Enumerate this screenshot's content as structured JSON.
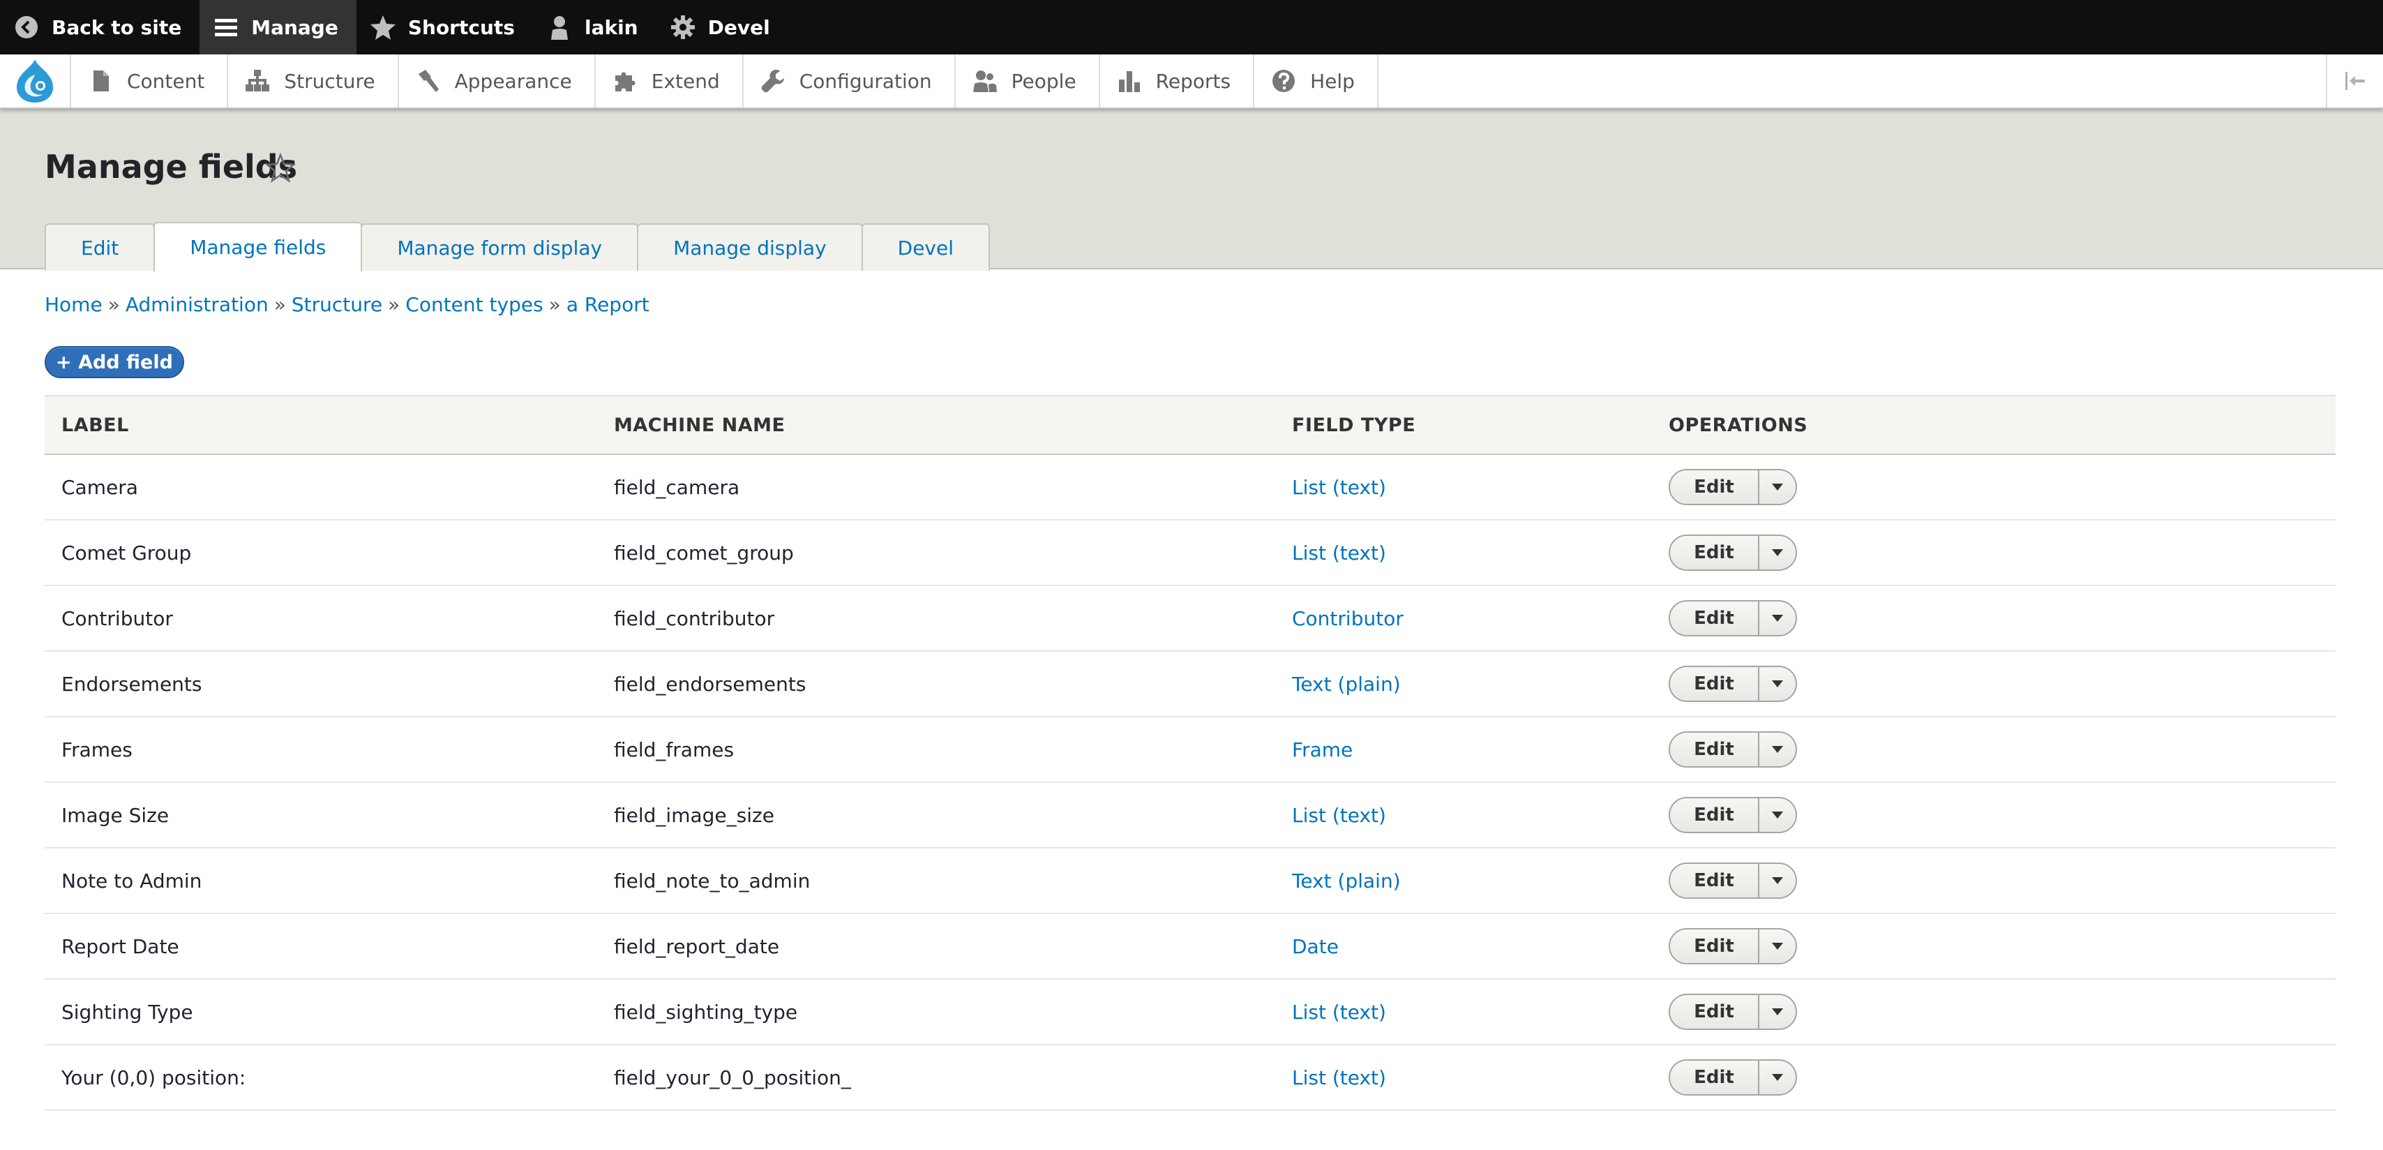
{
  "toolbar": {
    "items": [
      {
        "label": "Back to site",
        "icon": "back-arrow-circle-icon"
      },
      {
        "label": "Manage",
        "icon": "hamburger-menu-icon"
      },
      {
        "label": "Shortcuts",
        "icon": "star-icon"
      },
      {
        "label": "lakin",
        "icon": "user-icon"
      },
      {
        "label": "Devel",
        "icon": "gear-icon"
      }
    ]
  },
  "admin_menu": {
    "logo": "drupal-drop-icon",
    "items": [
      {
        "label": "Content",
        "icon": "page-icon"
      },
      {
        "label": "Structure",
        "icon": "sitemap-icon"
      },
      {
        "label": "Appearance",
        "icon": "paint-brush-icon"
      },
      {
        "label": "Extend",
        "icon": "puzzle-icon"
      },
      {
        "label": "Configuration",
        "icon": "wrench-icon"
      },
      {
        "label": "People",
        "icon": "people-icon"
      },
      {
        "label": "Reports",
        "icon": "bar-chart-icon"
      },
      {
        "label": "Help",
        "icon": "help-circle-icon"
      }
    ]
  },
  "page": {
    "title": "Manage fields"
  },
  "tabs": [
    {
      "label": "Edit",
      "active": false
    },
    {
      "label": "Manage fields",
      "active": true
    },
    {
      "label": "Manage form display",
      "active": false
    },
    {
      "label": "Manage display",
      "active": false
    },
    {
      "label": "Devel",
      "active": false
    }
  ],
  "breadcrumb": {
    "items": [
      "Home",
      "Administration",
      "Structure",
      "Content types",
      "a Report"
    ],
    "separator": "»"
  },
  "actions": {
    "add_field": "+ Add field"
  },
  "table": {
    "headers": [
      "LABEL",
      "MACHINE NAME",
      "FIELD TYPE",
      "OPERATIONS"
    ],
    "rows": [
      {
        "label": "Camera",
        "machine_name": "field_camera",
        "field_type": "List (text)",
        "op": "Edit"
      },
      {
        "label": "Comet Group",
        "machine_name": "field_comet_group",
        "field_type": "List (text)",
        "op": "Edit"
      },
      {
        "label": "Contributor",
        "machine_name": "field_contributor",
        "field_type": "Contributor",
        "op": "Edit"
      },
      {
        "label": "Endorsements",
        "machine_name": "field_endorsements",
        "field_type": "Text (plain)",
        "op": "Edit"
      },
      {
        "label": "Frames",
        "machine_name": "field_frames",
        "field_type": "Frame",
        "op": "Edit"
      },
      {
        "label": "Image Size",
        "machine_name": "field_image_size",
        "field_type": "List (text)",
        "op": "Edit"
      },
      {
        "label": "Note to Admin",
        "machine_name": "field_note_to_admin",
        "field_type": "Text (plain)",
        "op": "Edit"
      },
      {
        "label": "Report Date",
        "machine_name": "field_report_date",
        "field_type": "Date",
        "op": "Edit"
      },
      {
        "label": "Sighting Type",
        "machine_name": "field_sighting_type",
        "field_type": "List (text)",
        "op": "Edit"
      },
      {
        "label": "Your (0,0) position:",
        "machine_name": "field_your_0_0_position_",
        "field_type": "List (text)",
        "op": "Edit"
      }
    ]
  },
  "colors": {
    "toolbar_bg": "#0f0f0f",
    "link": "#0074bd",
    "header_bg": "#e0e0d8",
    "primary_button": "#2f6fba"
  }
}
